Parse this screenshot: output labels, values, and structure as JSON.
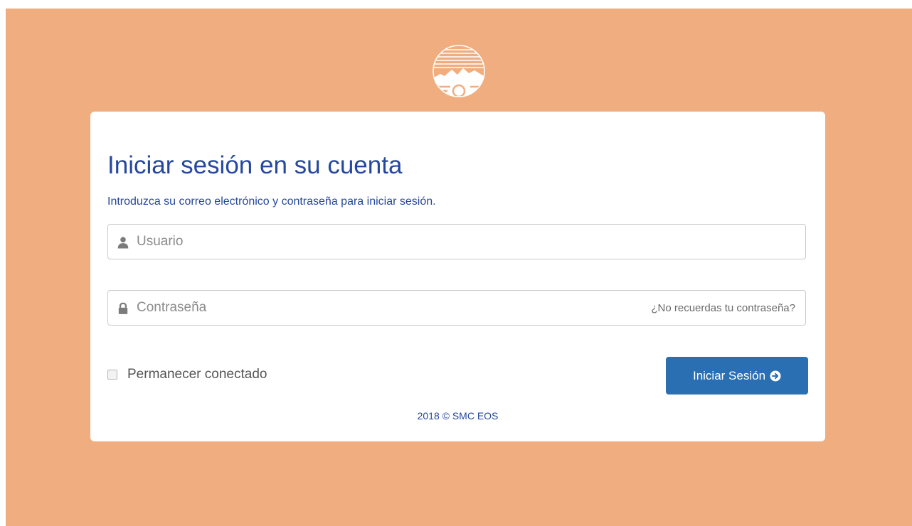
{
  "logo": {
    "icon": "eos-logo-icon",
    "alt_text": "EOS"
  },
  "login": {
    "title": "Iniciar sesión en su cuenta",
    "subtitle": "Introduzca su correo electrónico y contraseña para iniciar sesión.",
    "username": {
      "placeholder": "Usuario",
      "value": "",
      "icon": "user-icon"
    },
    "password": {
      "placeholder": "Contraseña",
      "value": "",
      "icon": "lock-icon"
    },
    "forgot_link": "¿No recuerdas tu contraseña?",
    "remember_label": "Permanecer conectado",
    "remember_checked": false,
    "submit_label": "Iniciar Sesión",
    "submit_icon": "arrow-circle-right-icon"
  },
  "footer": {
    "text": "2018 © SMC EOS"
  },
  "colors": {
    "background": "#f0ae80",
    "title": "#25479e",
    "button": "#2b6fb3"
  }
}
